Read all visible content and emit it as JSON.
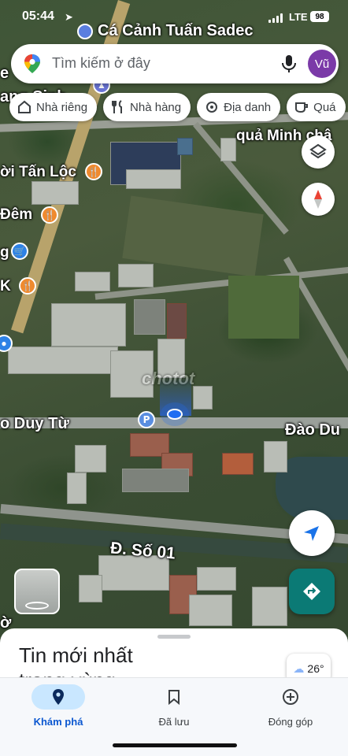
{
  "status_bar": {
    "time": "05:44",
    "network": "LTE",
    "battery": "98"
  },
  "top_place": "Cá Cảnh Tuấn Sadec",
  "search": {
    "placeholder": "Tìm kiếm ở đây",
    "avatar_initials": "Vũ"
  },
  "chips": [
    {
      "label": "Nhà riêng",
      "icon": "home-icon"
    },
    {
      "label": "Nhà hàng",
      "icon": "restaurant-icon"
    },
    {
      "label": "Địa danh",
      "icon": "landmark-icon"
    },
    {
      "label": "Quá",
      "icon": "cafe-icon"
    }
  ],
  "map_labels": {
    "e": "e",
    "ang_sinh": "ang Sinh",
    "qua_minh_chau": "quả Minh châ",
    "oi_tan_loc": "ời Tấn Lộc",
    "dem": "Đêm",
    "g": "g",
    "k": "K",
    "o_duy_tu": "o Duy Từ",
    "dao_du": "Đào Du",
    "d_so_01": "Đ. Số 01",
    "o": "ờ",
    "watermark": "chotot"
  },
  "sheet": {
    "title": "Tin mới nhất trong vùng",
    "weather": "26°"
  },
  "nav": [
    {
      "label": "Khám phá",
      "icon": "explore-pin-icon",
      "active": true
    },
    {
      "label": "Đã lưu",
      "icon": "bookmark-icon",
      "active": false
    },
    {
      "label": "Đóng góp",
      "icon": "add-circle-icon",
      "active": false
    }
  ],
  "colors": {
    "accent": "#0b57d0",
    "directions": "#0b7a75",
    "avatar": "#7b3aa8"
  }
}
